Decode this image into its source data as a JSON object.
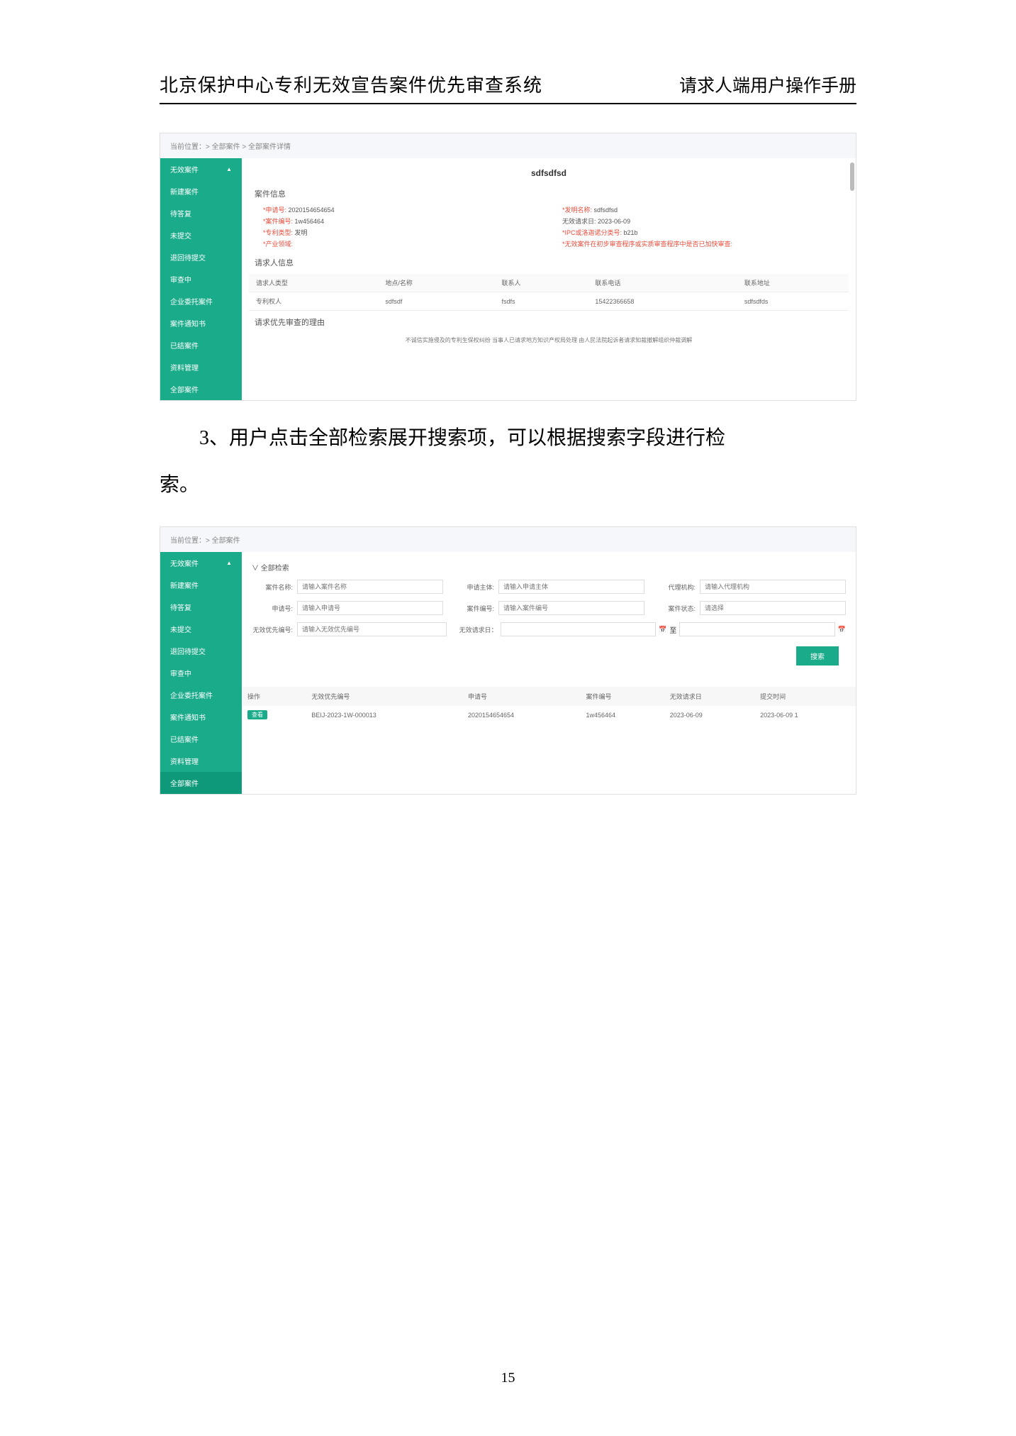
{
  "header": {
    "left": "北京保护中心专利无效宣告案件优先审查系统",
    "right": "请求人端用户操作手册"
  },
  "body_paragraph_line1": "3、用户点击全部检索展开搜索项，可以根据搜索字段进行检",
  "body_paragraph_line2": "索。",
  "page_number": "15",
  "shot1": {
    "breadcrumb": "当前位置：> 全部案件 > 全部案件详情",
    "sidebar": {
      "top": "无效案件",
      "items": [
        "新建案件",
        "待答复",
        "未提交",
        "退回待提交",
        "审查中",
        "企业委托案件",
        "案件通知书",
        "已结案件",
        "资料管理",
        "全部案件"
      ]
    },
    "title": "sdfsdfsd",
    "section_caseinfo": "案件信息",
    "caseinfo": {
      "app_no_label": "*申请号:",
      "app_no": "2020154654654",
      "inv_name_label": "*发明名称:",
      "inv_name": "sdfsdfsd",
      "case_no_label": "*案件编号:",
      "case_no": "1w456464",
      "req_date_label": "无效请求日:",
      "req_date": "2023-06-09",
      "patent_type_label": "*专利类型:",
      "patent_type": "发明",
      "ipc_label": "*IPC或洛迦诺分类号:",
      "ipc": "b21b",
      "industry_label": "*产业领域:",
      "fastcheck_label": "*无效案件在初步审查程序或实质审查程序中是否已加快审查:"
    },
    "section_requester": "请求人信息",
    "req_table": {
      "headers": [
        "请求人类型",
        "地点/名称",
        "联系人",
        "联系电话",
        "联系地址"
      ],
      "row": [
        "专利权人",
        "sdfsdf",
        "fsdfs",
        "15422366658",
        "sdfsdfds"
      ]
    },
    "section_reason": "请求优先审查的理由",
    "reason_text": "不诚信实施侵及的专利生保权纠纷   当事人已请求地方知识产权局处理   由人民法院起诉者请求知裁撤解组织仲裁调解"
  },
  "shot2": {
    "breadcrumb": "当前位置：> 全部案件",
    "sidebar": {
      "top": "无效案件",
      "items": [
        "新建案件",
        "待答复",
        "未提交",
        "退回待提交",
        "审查中",
        "企业委托案件",
        "案件通知书",
        "已结案件",
        "资料管理",
        "全部案件"
      ]
    },
    "search_toggle": "∨ 全部检索",
    "fields": {
      "case_name": {
        "label": "案件名称:",
        "ph": "请输入案件名称"
      },
      "applicant": {
        "label": "申请主体:",
        "ph": "请输入申请主体"
      },
      "agency": {
        "label": "代理机构:",
        "ph": "请输入代理机构"
      },
      "app_no": {
        "label": "申请号:",
        "ph": "请输入申请号"
      },
      "case_no": {
        "label": "案件编号:",
        "ph": "请输入案件编号"
      },
      "status": {
        "label": "案件状态:",
        "ph": "请选择"
      },
      "priority_no": {
        "label": "无效优先编号:",
        "ph": "请输入无效优先编号"
      },
      "req_date": {
        "label": "无效请求日：",
        "sep": "至"
      }
    },
    "search_btn": "搜索",
    "results": {
      "headers": [
        "操作",
        "无效优先编号",
        "申请号",
        "案件编号",
        "无效请求日",
        "提交时间"
      ],
      "row": {
        "op": "查看",
        "priority": "BEIJ-2023-1W-000013",
        "app": "2020154654654",
        "case": "1w456464",
        "reqdate": "2023-06-09",
        "submit": "2023-06-09 1"
      }
    }
  }
}
